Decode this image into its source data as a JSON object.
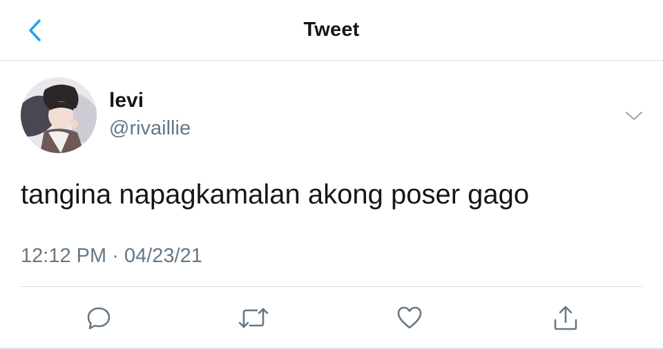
{
  "header": {
    "title": "Tweet",
    "back_icon": "chevron-left-icon",
    "accent": "#1da1f2"
  },
  "tweet": {
    "author_name": "levi",
    "author_handle": "@rivaillie",
    "text": "tangina napagkamalan akong poser gago",
    "time": "12:12 PM",
    "separator": "·",
    "date": "04/23/21"
  },
  "actions": {
    "reply_icon": "reply-icon",
    "retweet_icon": "retweet-icon",
    "like_icon": "heart-icon",
    "share_icon": "share-icon",
    "icon_color": "#657786"
  }
}
